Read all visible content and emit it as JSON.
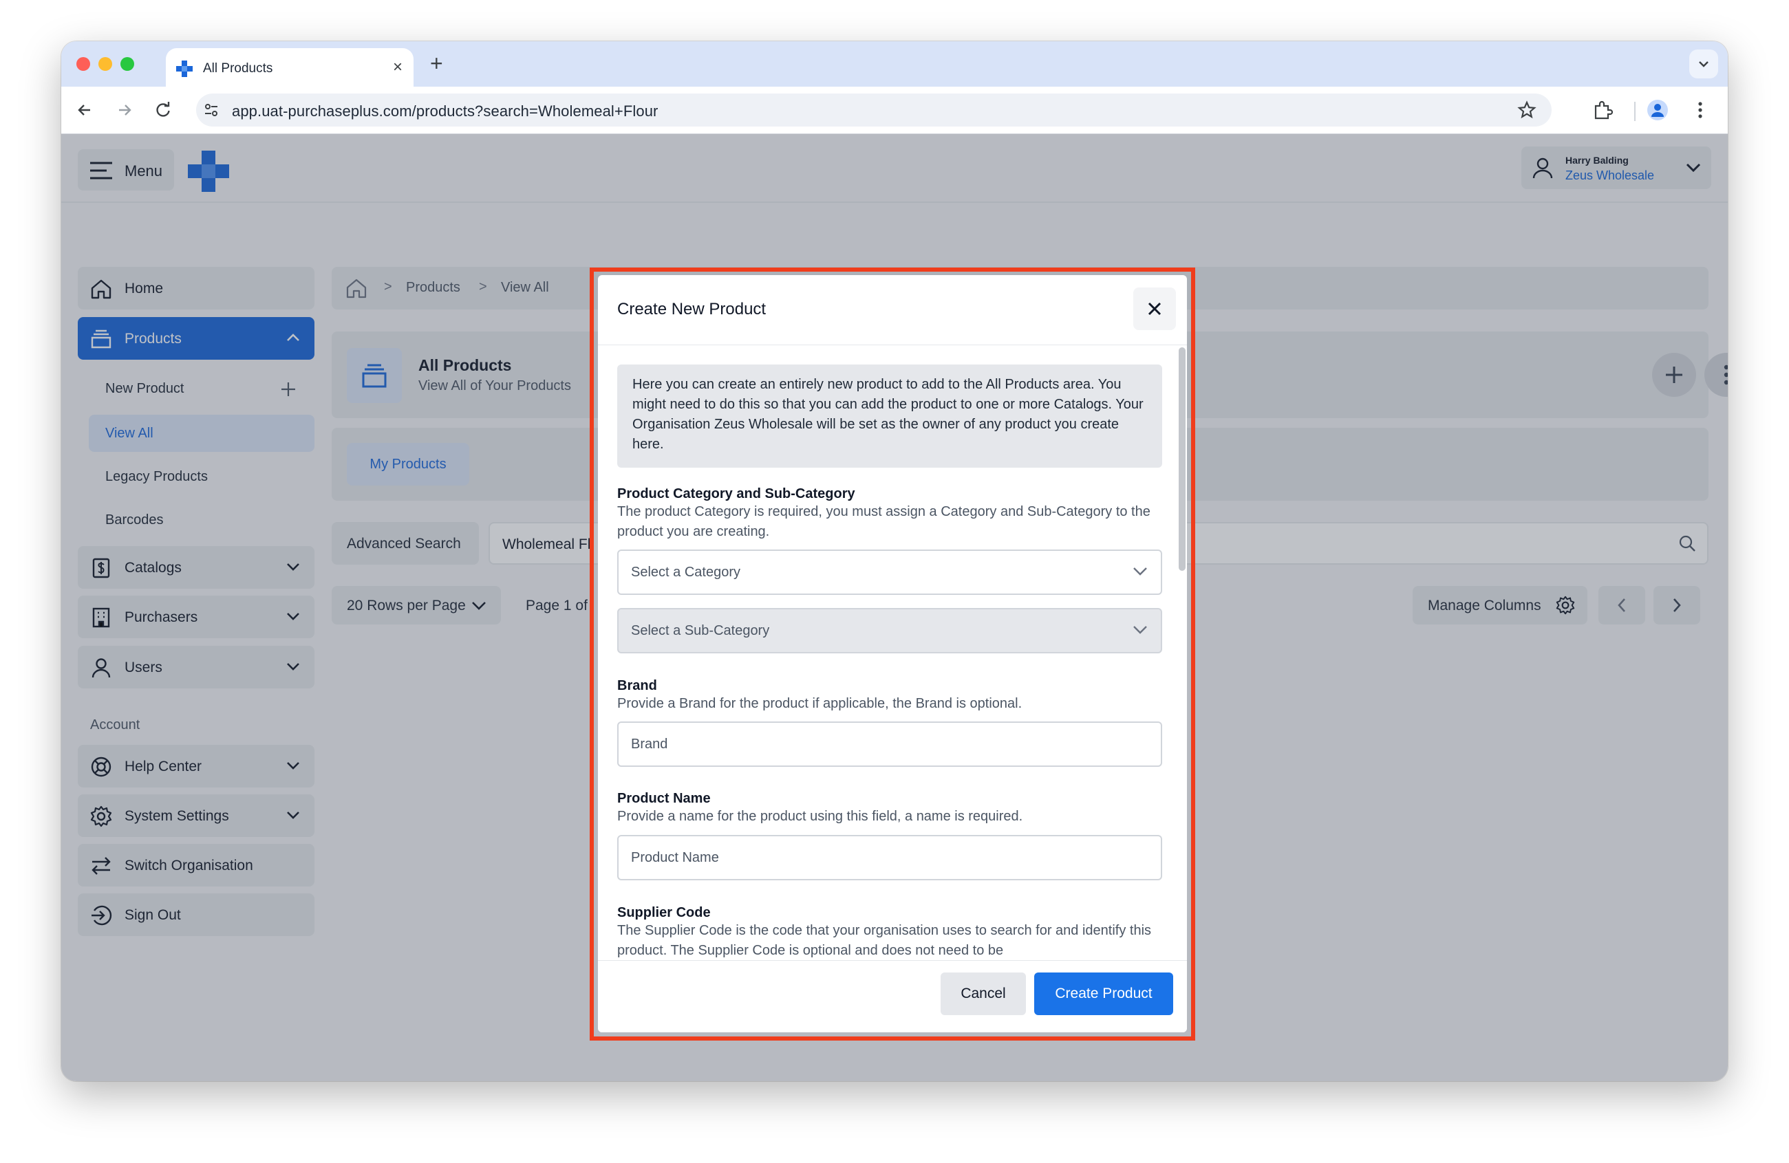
{
  "browser": {
    "tab_title": "All Products",
    "url": "app.uat-purchaseplus.com/products?search=Wholemeal+Flour"
  },
  "app": {
    "menu_label": "Menu",
    "user": {
      "name": "Harry Balding",
      "organisation": "Zeus Wholesale"
    }
  },
  "sidebar": {
    "items": [
      {
        "label": "Home"
      },
      {
        "label": "Products"
      },
      {
        "label": "Catalogs"
      },
      {
        "label": "Purchasers"
      },
      {
        "label": "Users"
      }
    ],
    "products_sub": [
      {
        "label": "New Product"
      },
      {
        "label": "View All"
      },
      {
        "label": "Legacy Products"
      },
      {
        "label": "Barcodes"
      }
    ],
    "account_label": "Account",
    "account_items": [
      {
        "label": "Help Center"
      },
      {
        "label": "System Settings"
      },
      {
        "label": "Switch Organisation"
      },
      {
        "label": "Sign Out"
      }
    ]
  },
  "main": {
    "breadcrumb": [
      "Products",
      "View All"
    ],
    "page_title": "All Products",
    "page_subtitle": "View All of Your Products",
    "tab_my_products": "My Products",
    "advanced_search": "Advanced Search",
    "search_value": "Wholemeal Fl",
    "rows_per_page": "20 Rows per Page",
    "page_info": "Page 1 of",
    "manage_columns": "Manage Columns"
  },
  "modal": {
    "title": "Create New Product",
    "intro": "Here you can create an entirely new product to add to the All Products area. You might need to do this so that you can add the product to one or more Catalogs. Your Organisation Zeus Wholesale will be set as the owner of any product you create here.",
    "category": {
      "label": "Product Category and Sub-Category",
      "help": "The product Category is required, you must assign a Category and Sub-Category to the product you are creating.",
      "category_placeholder": "Select a Category",
      "subcategory_placeholder": "Select a Sub-Category"
    },
    "brand": {
      "label": "Brand",
      "help": "Provide a Brand for the product if applicable, the Brand is optional.",
      "placeholder": "Brand"
    },
    "product_name": {
      "label": "Product Name",
      "help": "Provide a name for the product using this field, a name is required.",
      "placeholder": "Product Name"
    },
    "supplier_code": {
      "label": "Supplier Code",
      "help": "The Supplier Code is the code that your organisation uses to search for and identify this product. The Supplier Code is optional and does not need to be"
    },
    "cancel_label": "Cancel",
    "create_label": "Create Product"
  },
  "colors": {
    "accent": "#1a66d9",
    "highlight_border": "#f03d1c"
  }
}
